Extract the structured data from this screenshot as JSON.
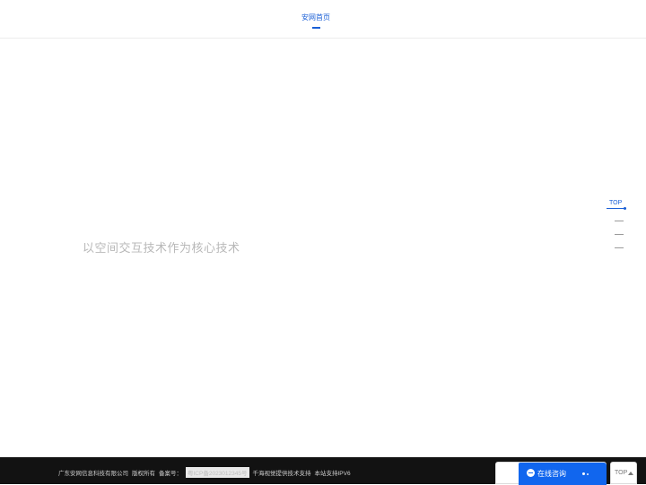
{
  "header": {
    "nav_home_label": "安网首页"
  },
  "hero": {
    "slogan": "以空间交互技术作为核心技术"
  },
  "side_nav": {
    "top_label": "TOP"
  },
  "footer": {
    "company": "广东安网信息科技有限公司",
    "copyright": "版权所有",
    "beian_label": "备案号：",
    "beian_number": "粤ICP备2023012345号",
    "tech_support": "千海视觉提供技术支持",
    "ipv6": "本站支持IPV6"
  },
  "consult_widget": {
    "label": "在线咨询",
    "icon": "chat-bubble-icon"
  },
  "back_to_top": {
    "label": "TOP",
    "icon": "arrow-up-icon"
  },
  "colors": {
    "accent": "#1a5fd6",
    "consult_blue": "#1166ee",
    "footer_bg": "#121212",
    "hero_text": "#b8b8b8"
  }
}
